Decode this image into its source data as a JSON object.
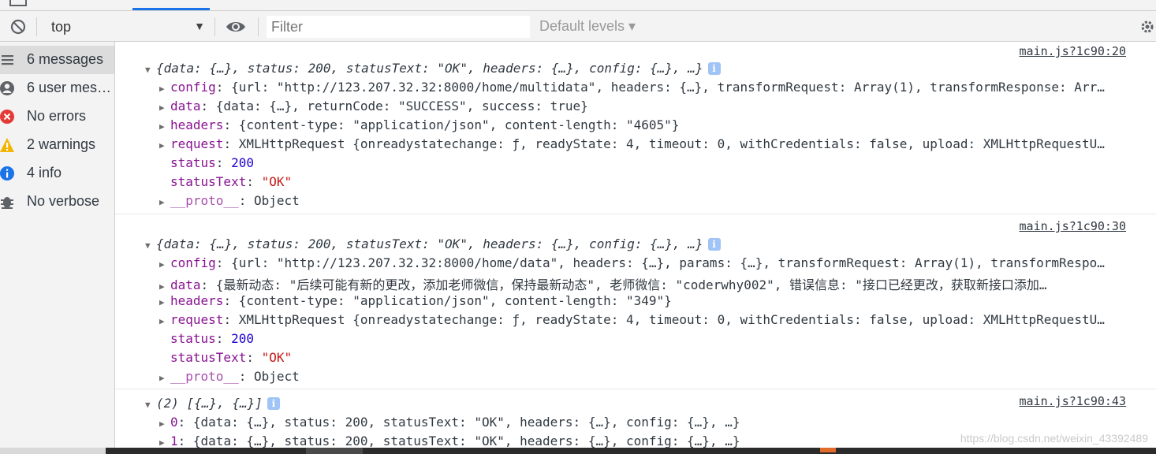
{
  "toolbar": {
    "context_value": "top",
    "filter_placeholder": "Filter",
    "levels_label": "Default levels ▾"
  },
  "sidebar": {
    "items": [
      {
        "label": "6 messages",
        "icon": "list-icon"
      },
      {
        "label": "6 user mess...",
        "icon": "user-icon"
      },
      {
        "label": "No errors",
        "icon": "error-icon"
      },
      {
        "label": "2 warnings",
        "icon": "warning-icon"
      },
      {
        "label": "4 info",
        "icon": "info-icon"
      },
      {
        "label": "No verbose",
        "icon": "bug-icon"
      }
    ]
  },
  "colors": {
    "error": "#e53935",
    "warning": "#f4b400",
    "info": "#1a73e8",
    "link": "#881391",
    "string": "#c41a16",
    "number": "#1c00cf"
  },
  "messages": [
    {
      "source": "main.js?1c90:20",
      "summary": "{data: {…}, status: 200, statusText: \"OK\", headers: {…}, config: {…}, …}",
      "lines": {
        "config": "{url: \"http://123.207.32.32:8000/home/multidata\", headers: {…}, transformRequest: Array(1), transformResponse: Arr…",
        "data": "{data: {…}, returnCode: \"SUCCESS\", success: true}",
        "headers": "{content-type: \"application/json\", content-length: \"4605\"}",
        "request": "XMLHttpRequest {onreadystatechange: ƒ, readyState: 4, timeout: 0, withCredentials: false, upload: XMLHttpRequestU…",
        "status": "200",
        "statusText": "\"OK\"",
        "proto": "Object"
      }
    },
    {
      "source": "main.js?1c90:30",
      "summary": "{data: {…}, status: 200, statusText: \"OK\", headers: {…}, config: {…}, …}",
      "lines": {
        "config": "{url: \"http://123.207.32.32:8000/home/data\", headers: {…}, params: {…}, transformRequest: Array(1), transformRespo…",
        "data": "{最新动态: \"后续可能有新的更改，添加老师微信，保持最新动态\", 老师微信: \"coderwhy002\", 错误信息: \"接口已经更改，获取新接口添加…",
        "headers": "{content-type: \"application/json\", content-length: \"349\"}",
        "request": "XMLHttpRequest {onreadystatechange: ƒ, readyState: 4, timeout: 0, withCredentials: false, upload: XMLHttpRequestU…",
        "status": "200",
        "statusText": "\"OK\"",
        "proto": "Object"
      }
    },
    {
      "source": "main.js?1c90:43",
      "summary": "(2) [{…}, {…}]",
      "items": [
        "{data: {…}, status: 200, statusText: \"OK\", headers: {…}, config: {…}, …}",
        "{data: {…}, status: 200, statusText: \"OK\", headers: {…}, config: {…}, …}"
      ]
    }
  ],
  "watermark": "https://blog.csdn.net/weixin_43392489"
}
